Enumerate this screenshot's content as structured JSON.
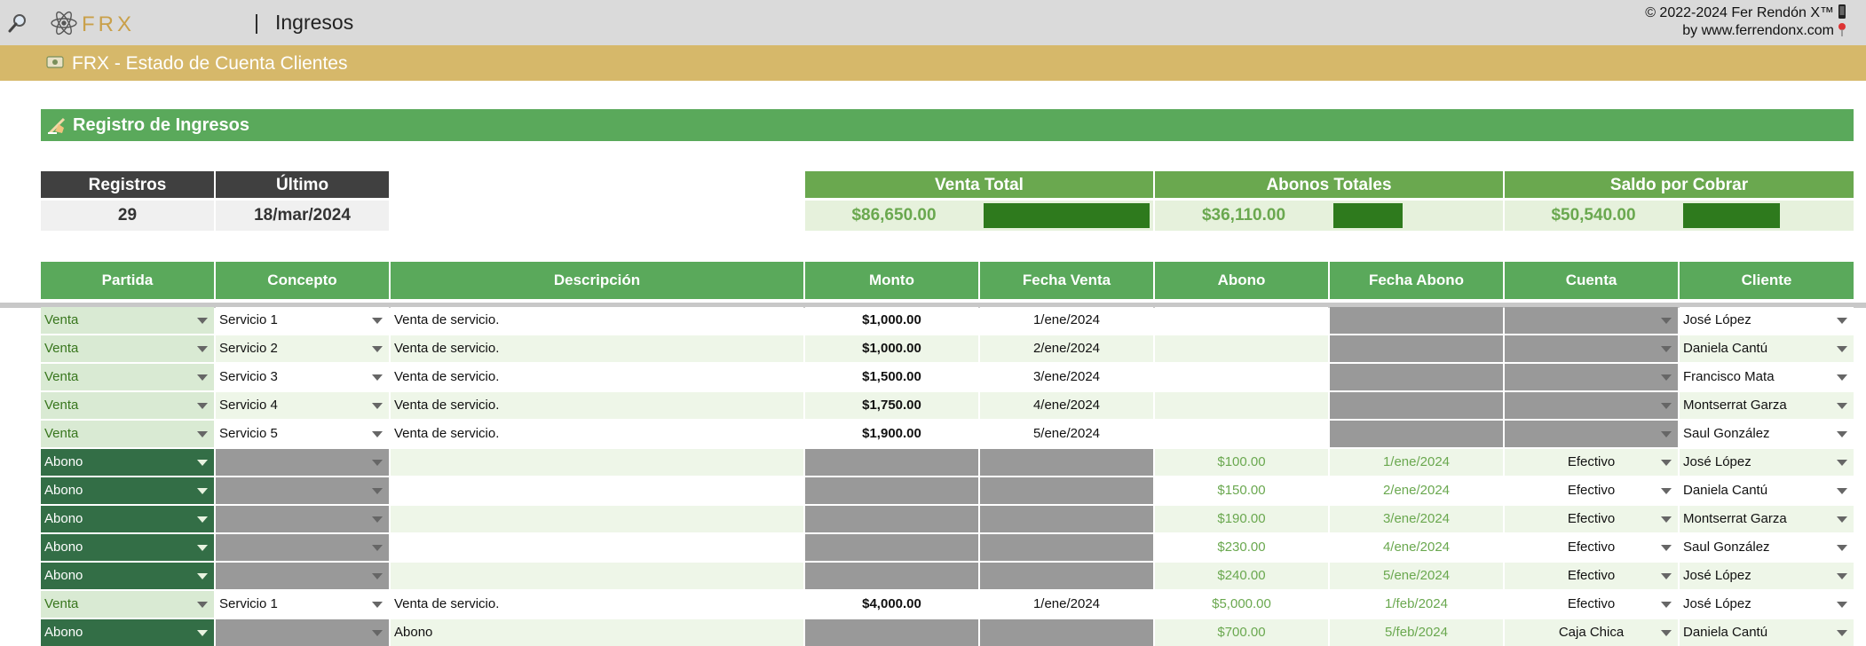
{
  "header": {
    "app_title": "Ingresos",
    "separator": "|",
    "copyright_line1": "© 2022-2024 Fer Rendón X™",
    "copyright_line2": "by www.ferrendonx.com",
    "logo_text": "FRX"
  },
  "subheader": {
    "title": "FRX - Estado de Cuenta Clientes"
  },
  "section": {
    "title": "Registro de Ingresos"
  },
  "stats": {
    "registros_label": "Registros",
    "registros_value": "29",
    "ultimo_label": "Último",
    "ultimo_value": "18/mar/2024"
  },
  "summary": {
    "venta_total_label": "Venta Total",
    "venta_total_value": "$86,650.00",
    "abonos_totales_label": "Abonos Totales",
    "abonos_totales_value": "$36,110.00",
    "saldo_label": "Saldo por Cobrar",
    "saldo_value": "$50,540.00",
    "colors": {
      "header": "#6aa84f",
      "value": "#6aa84f",
      "bar": "#2e7a1d",
      "band": "#e6f1dc"
    }
  },
  "table": {
    "headers": [
      "Partida",
      "Concepto",
      "Descripción",
      "Monto",
      "Fecha Venta",
      "Abono",
      "Fecha Abono",
      "Cuenta",
      "Cliente"
    ],
    "rows": [
      {
        "partida": "Venta",
        "concepto": "Servicio 1",
        "descripcion": "Venta de servicio.",
        "monto": "$1,000.00",
        "fecha_venta": "1/ene/2024",
        "abono": "",
        "fecha_abono": "",
        "cuenta": "",
        "cliente": "José López"
      },
      {
        "partida": "Venta",
        "concepto": "Servicio 2",
        "descripcion": "Venta de servicio.",
        "monto": "$1,000.00",
        "fecha_venta": "2/ene/2024",
        "abono": "",
        "fecha_abono": "",
        "cuenta": "",
        "cliente": "Daniela Cantú"
      },
      {
        "partida": "Venta",
        "concepto": "Servicio 3",
        "descripcion": "Venta de servicio.",
        "monto": "$1,500.00",
        "fecha_venta": "3/ene/2024",
        "abono": "",
        "fecha_abono": "",
        "cuenta": "",
        "cliente": "Francisco Mata"
      },
      {
        "partida": "Venta",
        "concepto": "Servicio 4",
        "descripcion": "Venta de servicio.",
        "monto": "$1,750.00",
        "fecha_venta": "4/ene/2024",
        "abono": "",
        "fecha_abono": "",
        "cuenta": "",
        "cliente": "Montserrat Garza"
      },
      {
        "partida": "Venta",
        "concepto": "Servicio 5",
        "descripcion": "Venta de servicio.",
        "monto": "$1,900.00",
        "fecha_venta": "5/ene/2024",
        "abono": "",
        "fecha_abono": "",
        "cuenta": "",
        "cliente": "Saul González"
      },
      {
        "partida": "Abono",
        "concepto": "",
        "descripcion": "",
        "monto": "",
        "fecha_venta": "",
        "abono": "$100.00",
        "fecha_abono": "1/ene/2024",
        "cuenta": "Efectivo",
        "cliente": "José López"
      },
      {
        "partida": "Abono",
        "concepto": "",
        "descripcion": "",
        "monto": "",
        "fecha_venta": "",
        "abono": "$150.00",
        "fecha_abono": "2/ene/2024",
        "cuenta": "Efectivo",
        "cliente": "Daniela Cantú"
      },
      {
        "partida": "Abono",
        "concepto": "",
        "descripcion": "",
        "monto": "",
        "fecha_venta": "",
        "abono": "$190.00",
        "fecha_abono": "3/ene/2024",
        "cuenta": "Efectivo",
        "cliente": "Montserrat Garza"
      },
      {
        "partida": "Abono",
        "concepto": "",
        "descripcion": "",
        "monto": "",
        "fecha_venta": "",
        "abono": "$230.00",
        "fecha_abono": "4/ene/2024",
        "cuenta": "Efectivo",
        "cliente": "Saul González"
      },
      {
        "partida": "Abono",
        "concepto": "",
        "descripcion": "",
        "monto": "",
        "fecha_venta": "",
        "abono": "$240.00",
        "fecha_abono": "5/ene/2024",
        "cuenta": "Efectivo",
        "cliente": "José López"
      },
      {
        "partida": "Venta",
        "concepto": "Servicio 1",
        "descripcion": "Venta de servicio.",
        "monto": "$4,000.00",
        "fecha_venta": "1/ene/2024",
        "abono": "$5,000.00",
        "fecha_abono": "1/feb/2024",
        "cuenta": "Efectivo",
        "cliente": "José López"
      },
      {
        "partida": "Abono",
        "concepto": "",
        "descripcion": "Abono",
        "monto": "",
        "fecha_venta": "",
        "abono": "$700.00",
        "fecha_abono": "5/feb/2024",
        "cuenta": "Caja Chica",
        "cliente": "Daniela Cantú"
      }
    ]
  },
  "icons": [
    "search-icon",
    "atom-logo-icon",
    "money-icon",
    "writing-hand-icon",
    "phone-icon",
    "pin-icon",
    "chevron-down-icon"
  ]
}
